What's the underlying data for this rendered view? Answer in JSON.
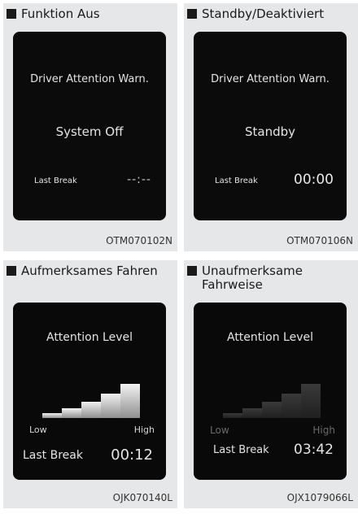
{
  "panels": [
    {
      "caption": "Funktion Aus",
      "screen": {
        "title": "Driver Attention Warn.",
        "status": "System Off",
        "last_break_label": "Last Break",
        "last_break_time": "--:--"
      },
      "code": "OTM070102N"
    },
    {
      "caption": "Standby/Deaktiviert",
      "screen": {
        "title": "Driver Attention Warn.",
        "status": "Standby",
        "last_break_label": "Last Break",
        "last_break_time": "00:00"
      },
      "code": "OTM070106N"
    },
    {
      "caption": "Aufmerksames Fahren",
      "screen": {
        "title": "Attention Level",
        "low": "Low",
        "high": "High",
        "last_break_label": "Last Break",
        "last_break_time": "00:12",
        "active_bars": 5,
        "total_bars": 5
      },
      "code": "OJK070140L"
    },
    {
      "caption": "Unaufmerksame Fahrweise",
      "screen": {
        "title": "Attention Level",
        "low": "Low",
        "high": "High",
        "last_break_label": "Last Break",
        "last_break_time": "03:42",
        "active_bars": 0,
        "total_bars": 5
      },
      "code": "OJX1079066L"
    }
  ],
  "colors": {
    "panel_bg": "#e6e7e8",
    "screen_bg": "#0b0b0b",
    "bullet": "#1a1a1a"
  },
  "icons": [
    "square-bullet-icon"
  ]
}
